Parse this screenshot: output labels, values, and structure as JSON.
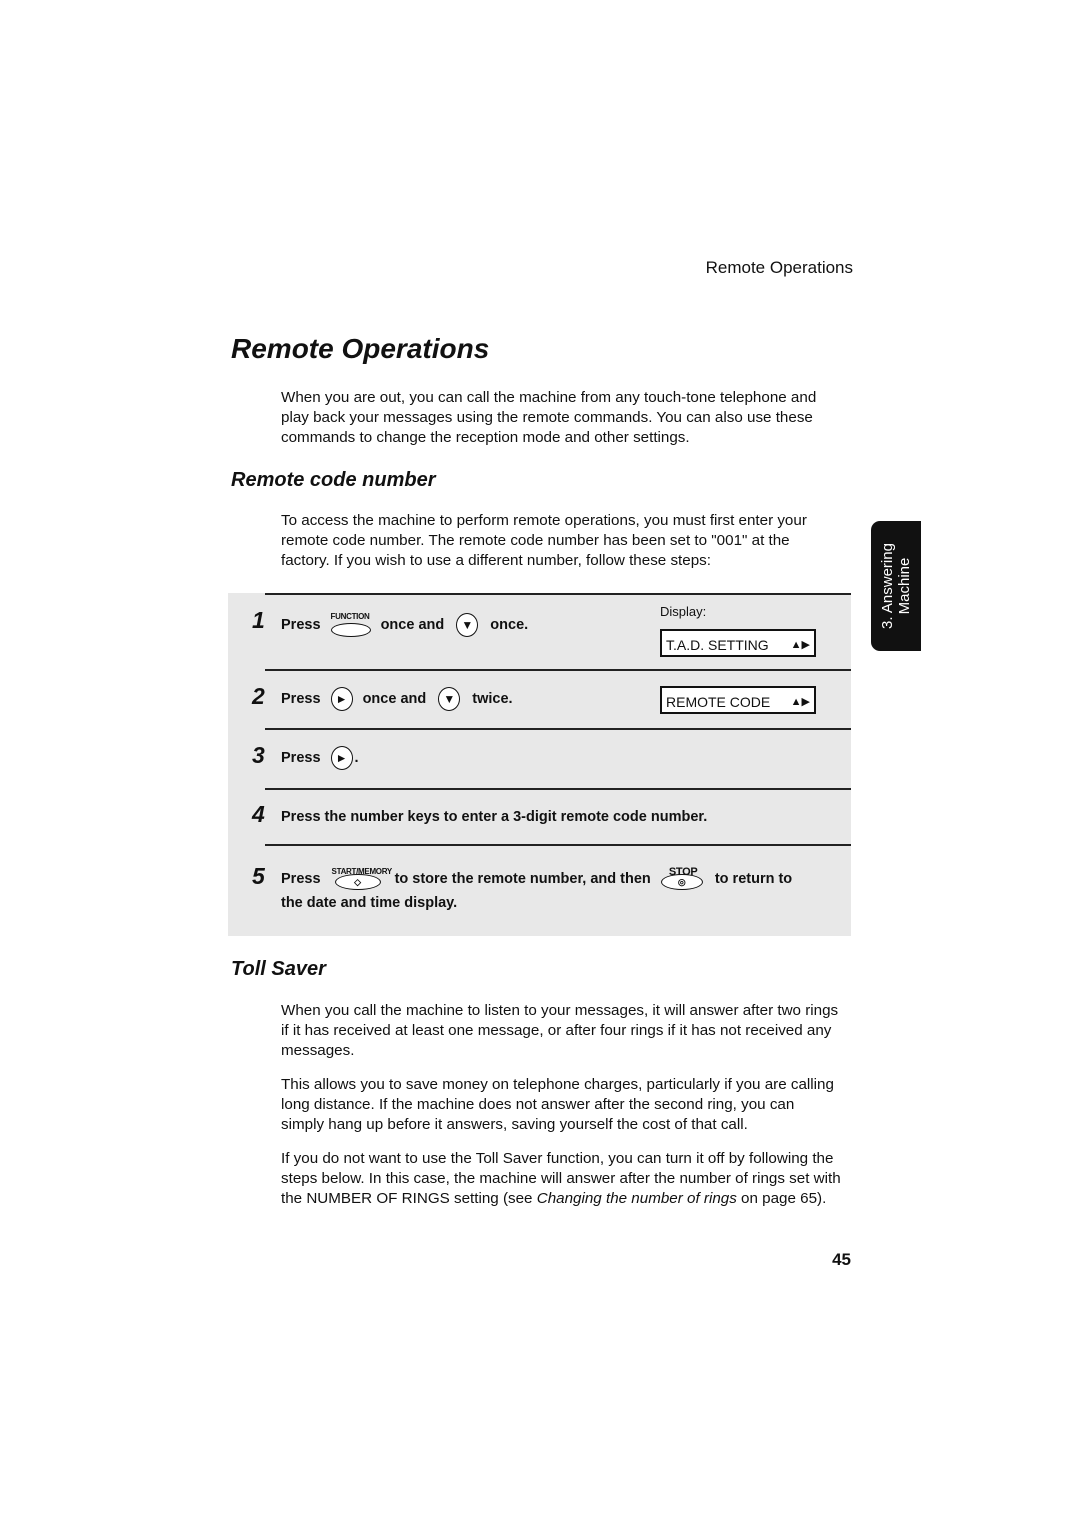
{
  "header": "Remote Operations",
  "title": "Remote Operations",
  "intro": "When you are out, you can call the machine from any touch-tone telephone and play back your messages using the remote commands. You can also use these commands to change the reception mode and other settings.",
  "section1": {
    "title": "Remote code number",
    "text": "To access the machine to perform remote operations, you must first enter your remote code number. The remote code number has been set to \"001\" at the factory. If you wish to use a different number, follow these steps:"
  },
  "side_tab": {
    "line1": "3. Answering",
    "line2": "Machine"
  },
  "display_label": "Display:",
  "steps": [
    {
      "num": "1",
      "press": "Press",
      "key1": "FUNCTION",
      "mid": "once and",
      "end": "once.",
      "display": "T.A.D. SETTING"
    },
    {
      "num": "2",
      "press": "Press",
      "mid": "once and",
      "end": "twice.",
      "display": "REMOTE CODE"
    },
    {
      "num": "3",
      "press": "Press",
      "end": "."
    },
    {
      "num": "4",
      "text": "Press the number keys to enter a 3-digit remote code number."
    },
    {
      "num": "5",
      "press": "Press",
      "key1": "START/MEMORY",
      "mid": "to store the remote number, and then",
      "key2": "STOP",
      "end": "to return to",
      "line2": "the date and time display."
    }
  ],
  "section2": {
    "title": "Toll Saver",
    "p1": "When you call the machine to listen to your messages, it will answer after two rings if it has received at least one message, or after four rings if it has not received any messages.",
    "p2": "This allows you to save money on telephone charges, particularly if you are calling long distance. If the machine does not answer after the second ring, you can simply hang up before it answers, saving yourself the cost of that call.",
    "p3a": "If you do not want to use the Toll Saver function, you can turn it off by following the steps below. In this case, the machine will answer after the number of rings set with the NUMBER OF RINGS setting (see ",
    "p3link": "Changing the number of rings",
    "p3b": " on page 65)."
  },
  "page_number": "45"
}
